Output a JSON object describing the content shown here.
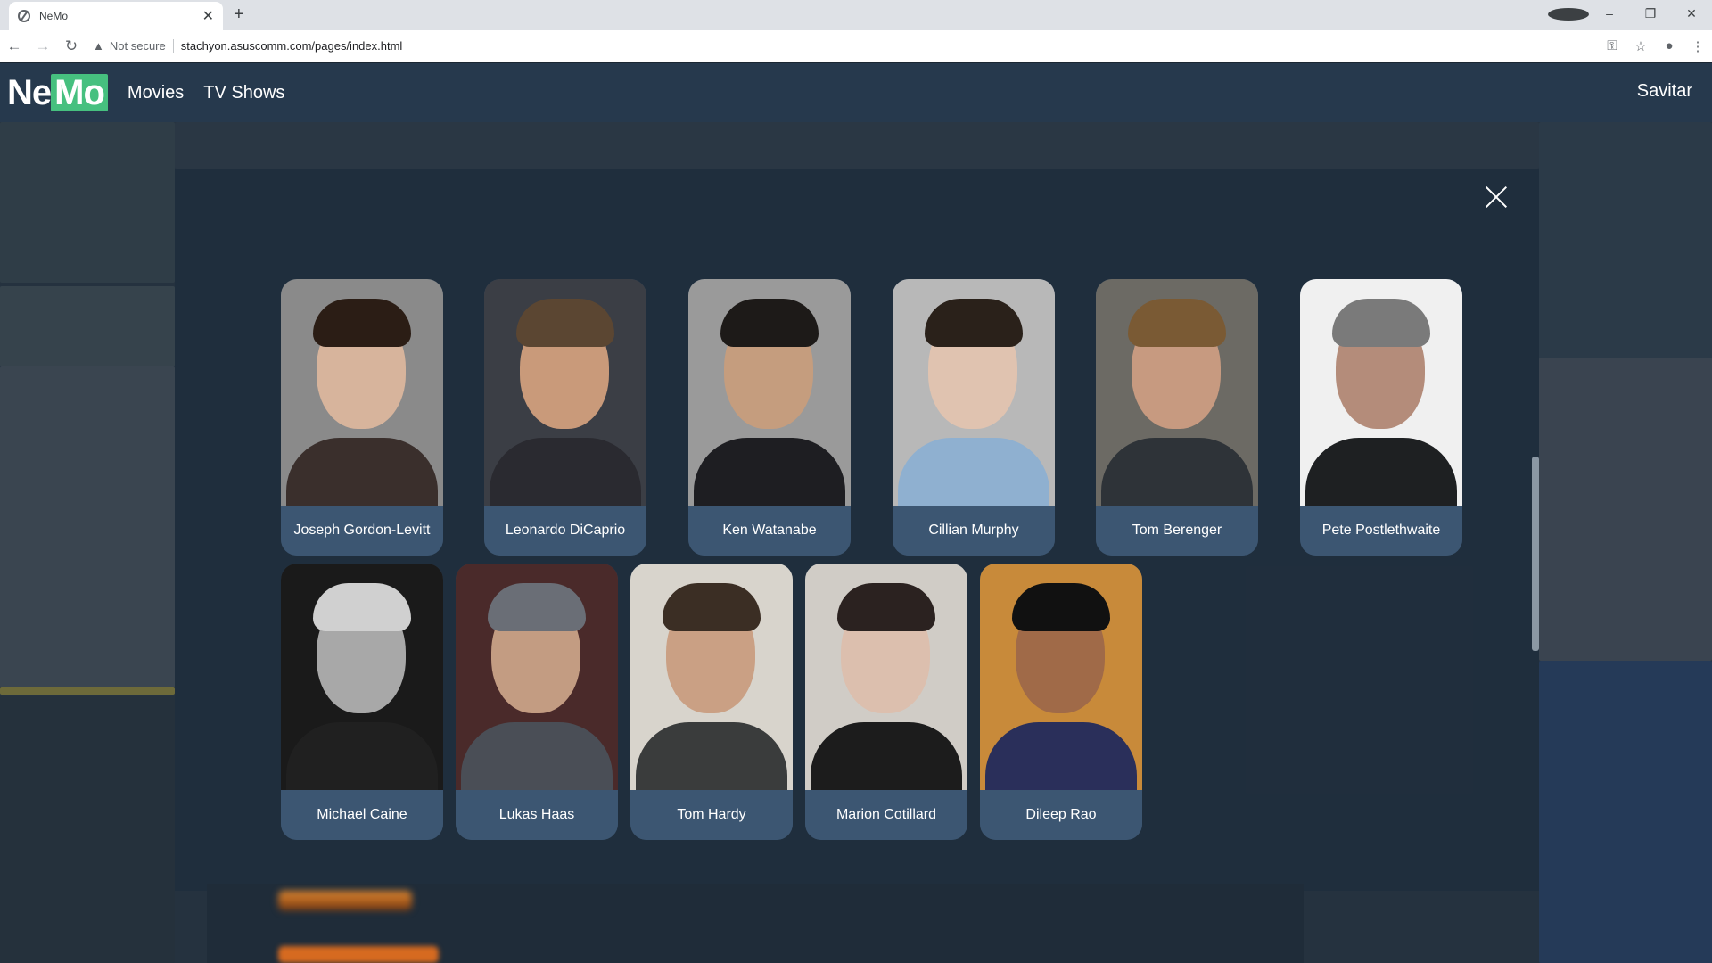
{
  "browser": {
    "tab_title": "NeMo",
    "tab_close": "✕",
    "new_tab": "+",
    "not_secure": "Not secure",
    "url": "stachyon.asuscomm.com/pages/index.html",
    "minimize": "–",
    "restore": "❐",
    "close": "✕"
  },
  "navbar": {
    "logo_ne": "Ne",
    "logo_mo": "Mo",
    "links": [
      "Movies",
      "TV Shows"
    ],
    "user": "Savitar"
  },
  "cast": [
    {
      "name": "Joseph Gordon-Levitt",
      "bg": "#8a8a8a",
      "skin": "#d7b49c",
      "hair": "#2b1d15",
      "cloth": "#3a2f2c"
    },
    {
      "name": "Leonardo DiCaprio",
      "bg": "#3b3e45",
      "skin": "#c99a7a",
      "hair": "#5b4632",
      "cloth": "#2a2a30"
    },
    {
      "name": "Ken Watanabe",
      "bg": "#9a9a9a",
      "skin": "#c59d7e",
      "hair": "#1d1a18",
      "cloth": "#1e1e22"
    },
    {
      "name": "Cillian Murphy",
      "bg": "#b8b8b8",
      "skin": "#e0c3b0",
      "hair": "#2a211a",
      "cloth": "#8fb0d0"
    },
    {
      "name": "Tom Berenger",
      "bg": "#6c6a64",
      "skin": "#c79a80",
      "hair": "#7a5a34",
      "cloth": "#2e3338"
    },
    {
      "name": "Pete Postlethwaite",
      "bg": "#f0f0f0",
      "skin": "#b48c7a",
      "hair": "#7a7a7a",
      "cloth": "#1e2022"
    },
    {
      "name": "Michael Caine",
      "bg": "#1a1a1a",
      "skin": "#a8a8a8",
      "hair": "#d0d0d0",
      "cloth": "#202020"
    },
    {
      "name": "Lukas Haas",
      "bg": "#4a2a2a",
      "skin": "#c39c82",
      "hair": "#6a6e76",
      "cloth": "#4a4e56"
    },
    {
      "name": "Tom Hardy",
      "bg": "#d8d4cc",
      "skin": "#caa084",
      "hair": "#3b2e24",
      "cloth": "#3a3c3c"
    },
    {
      "name": "Marion Cotillard",
      "bg": "#d0ccc6",
      "skin": "#dcbfae",
      "hair": "#2b2220",
      "cloth": "#1c1c1c"
    },
    {
      "name": "Dileep Rao",
      "bg": "#c88a3a",
      "skin": "#a06a48",
      "hair": "#111111",
      "cloth": "#2a2f5a"
    }
  ]
}
